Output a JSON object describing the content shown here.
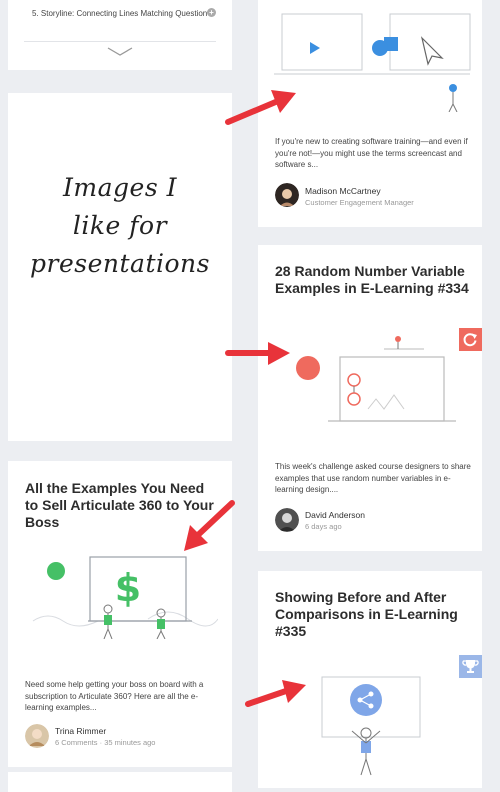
{
  "toc": {
    "item_label": "5. Storyline: Connecting Lines Matching Question",
    "plus_icon": "+"
  },
  "note": {
    "line1": "Images I",
    "line2": "like for",
    "line3": "presentations"
  },
  "cards": {
    "screencast": {
      "excerpt": "If you're new to creating software training—and even if you're not!—you might use the terms screencast and software s...",
      "author": "Madison McCartney",
      "role": "Customer Engagement Manager"
    },
    "random_number": {
      "title": "28 Random Number Variable Examples in E-Learning #334",
      "excerpt": "This week's challenge asked course designers to share examples that use random number variables in e-learning design....",
      "author": "David Anderson",
      "time": "6 days ago",
      "badge_color": "#ef6a5e",
      "badge_icon": "refresh-icon"
    },
    "articulate": {
      "title": "All the Examples You Need to Sell Articulate 360 to Your Boss",
      "excerpt": "Need some help getting your boss on board with a subscription to Articulate 360? Here are all the e-learning examples...",
      "author": "Trina Rimmer",
      "comments": "6 Comments",
      "separator": " · ",
      "time": "35 minutes ago"
    },
    "before_after": {
      "title": "Showing Before and After Comparisons in E-Learning #335",
      "badge_color": "#9bb7e8",
      "badge_icon": "trophy-icon"
    }
  },
  "colors": {
    "arrow": "#e8333a",
    "accent_green": "#45c066",
    "accent_blue": "#3b8fe0",
    "accent_red": "#ef6a5e"
  }
}
